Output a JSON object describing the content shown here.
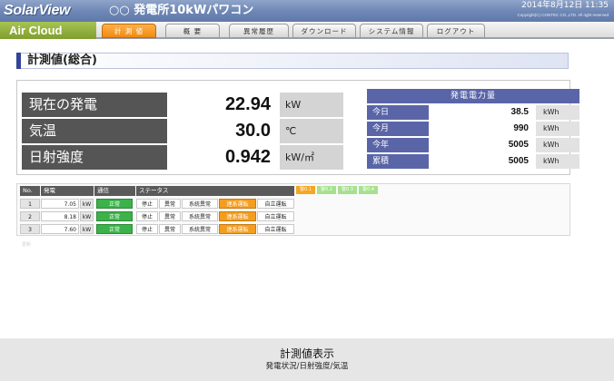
{
  "header": {
    "logo": "SolarView",
    "site_title": "○○ 発電所10kWパワコン",
    "datetime": "2014年8月12日  11:35",
    "copyright": "Copyright(C) CONTEC CO.,LTD. All right reserved"
  },
  "nav": {
    "brand": "Air Cloud",
    "tabs": [
      "計 測 値",
      "概 要",
      "異常履歴",
      "ダウンロード",
      "システム情報",
      "ログアウト"
    ],
    "active_index": 0
  },
  "section_title": "計測値(総合)",
  "measurements": [
    {
      "label": "現在の発電",
      "value": "22.94",
      "unit": "kW"
    },
    {
      "label": "気温",
      "value": "30.0",
      "unit": "℃"
    },
    {
      "label": "日射強度",
      "value": "0.942",
      "unit": "kW/㎡"
    }
  ],
  "energy": {
    "title": "発電電力量",
    "rows": [
      {
        "label": "今日",
        "value": "38.5",
        "unit": "kWh"
      },
      {
        "label": "今月",
        "value": "990",
        "unit": "kWh"
      },
      {
        "label": "今年",
        "value": "5005",
        "unit": "kWh"
      },
      {
        "label": "累積",
        "value": "5005",
        "unit": "kWh"
      }
    ]
  },
  "status_table": {
    "headers": [
      "No.",
      "発電",
      "通信",
      "ステータス"
    ],
    "legend": [
      "警0.1",
      "警0.2",
      "警0.3",
      "警0.4"
    ],
    "rows": [
      {
        "no": "1",
        "power": "7.05",
        "unit": "kW",
        "comm": "正常",
        "status": [
          "停止",
          "異常",
          "系統異常",
          "連系運転",
          "自立運転"
        ]
      },
      {
        "no": "2",
        "power": "8.18",
        "unit": "kW",
        "comm": "正常",
        "status": [
          "停止",
          "異常",
          "系統異常",
          "連系運転",
          "自立運転"
        ]
      },
      {
        "no": "3",
        "power": "7.60",
        "unit": "kW",
        "comm": "正常",
        "status": [
          "停止",
          "異常",
          "系統異常",
          "連系運転",
          "自立運転"
        ]
      }
    ],
    "note": "更新"
  },
  "caption": {
    "title": "計測値表示",
    "subtitle": "発電状況/日射強度/気温"
  },
  "colors": {
    "header": "#6d86b4",
    "brand_green": "#8fb03c",
    "active_tab": "#f08a10",
    "label_gray": "#555555",
    "energy_blue": "#5a65a8",
    "ok_green": "#3bb24a",
    "amber": "#f59d1e"
  }
}
